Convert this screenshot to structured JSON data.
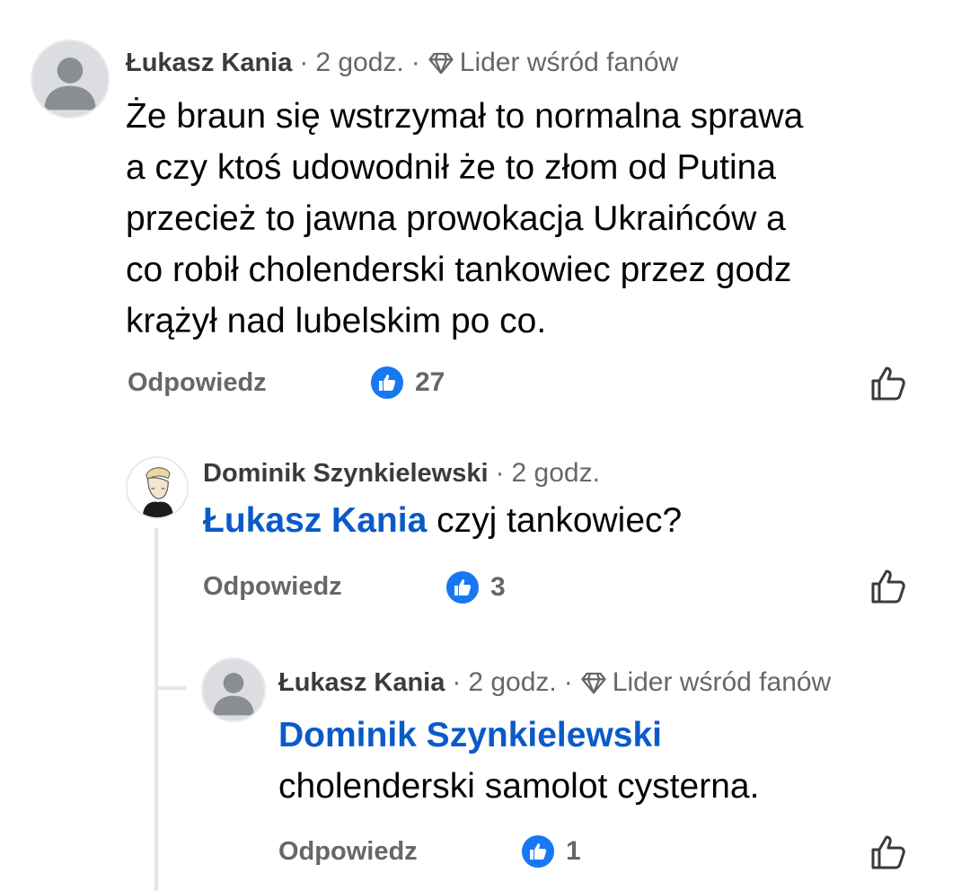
{
  "comments": [
    {
      "author": "Łukasz Kania",
      "separator1": "·",
      "time": "2 godz.",
      "separator2": "·",
      "badge": "Lider wśród fanów",
      "badge_icon": "diamond-icon",
      "text_lines": [
        "Że braun się wstrzymał to normalna sprawa",
        "a czy ktoś udowodnił że to złom od Putina",
        "przecież to jawna prowokacja Ukraińców a",
        "co robił cholenderski tankowiec przez godz",
        "krążył nad lubelskim po co."
      ],
      "reply_label": "Odpowiedz",
      "likes": "27"
    },
    {
      "author": "Dominik Szynkielewski",
      "separator1": "·",
      "time": "2 godz.",
      "mention": "Łukasz Kania",
      "text": " czyj tankowiec?",
      "reply_label": "Odpowiedz",
      "likes": "3"
    },
    {
      "author": "Łukasz Kania",
      "separator1": "·",
      "time": "2 godz.",
      "separator2": "·",
      "badge": "Lider wśród fanów",
      "badge_icon": "diamond-icon",
      "mention": "Dominik Szynkielewski",
      "text": "cholenderski samolot cysterna.",
      "reply_label": "Odpowiedz",
      "likes": "1"
    }
  ],
  "colors": {
    "mention": "#0a5ac8",
    "like_badge": "#1877f2",
    "meta": "#65676b",
    "text": "#050505"
  }
}
